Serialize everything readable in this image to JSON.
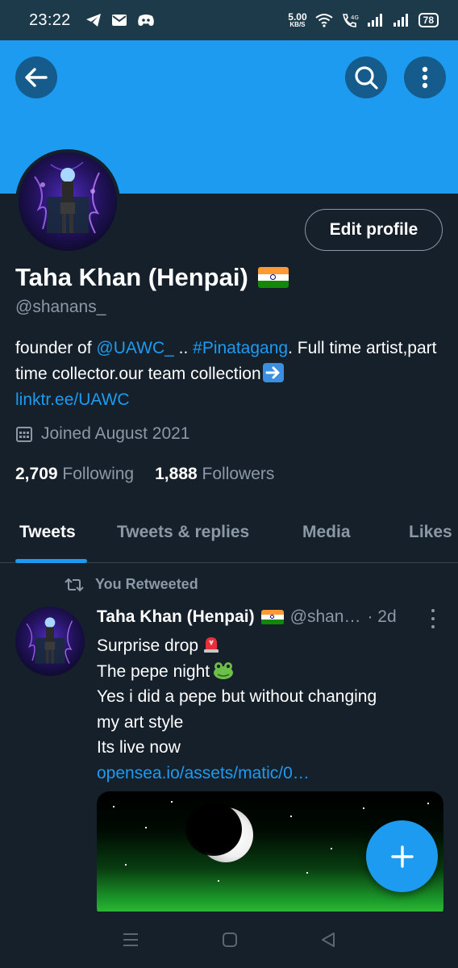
{
  "status_bar": {
    "time": "23:22",
    "notification_icons": [
      "telegram-icon",
      "gmail-icon",
      "discord-icon"
    ],
    "net_speed_value": "5.00",
    "net_speed_unit": "KB/S",
    "battery": "78"
  },
  "header": {
    "back_icon": "arrow-left-icon",
    "search_icon": "search-icon",
    "more_icon": "more-vertical-icon"
  },
  "profile": {
    "edit_button": "Edit profile",
    "name": "Taha Khan (Henpai)",
    "handle": "@shanans_",
    "bio": {
      "prefix": "founder of ",
      "mention": "@UAWC_",
      "mid": " .. ",
      "hashtag": "#Pinatagang",
      "suffix": ". Full time artist,part time collector.our team collection",
      "link": "linktr.ee/UAWC"
    },
    "joined": "Joined August 2021",
    "following_count": "2,709",
    "following_label": "Following",
    "followers_count": "1,888",
    "followers_label": "Followers"
  },
  "tabs": [
    {
      "label": "Tweets",
      "active": true
    },
    {
      "label": "Tweets & replies",
      "active": false
    },
    {
      "label": "Media",
      "active": false
    },
    {
      "label": "Likes",
      "active": false
    }
  ],
  "tweet": {
    "retweet_label": "You Retweeted",
    "author_name": "Taha Khan (Henpai)",
    "author_handle": "@shan…",
    "date": "· 2d",
    "lines": [
      "Surprise drop",
      "The pepe night",
      "Yes i did a pepe but without changing",
      "my art style",
      "Its live now"
    ],
    "link": "opensea.io/assets/matic/0…"
  },
  "colors": {
    "accent": "#1d9bf0",
    "background": "#15202b",
    "secondary_text": "#8b98a5"
  }
}
